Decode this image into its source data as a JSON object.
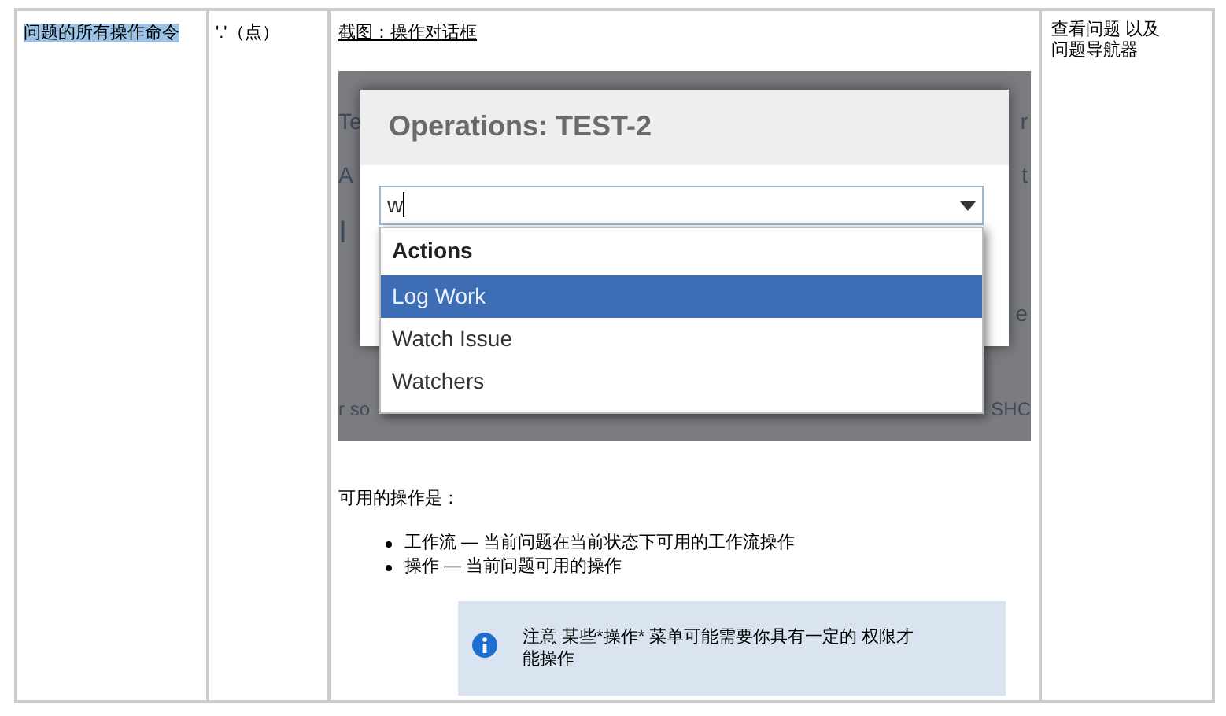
{
  "table": {
    "row": {
      "command": {
        "text": "问题的所有操作命令",
        "highlighted": true
      },
      "shortcut": "'.'（点）",
      "description": {
        "caption": "截图：操作对话框",
        "screenshot": {
          "background_fragments": [
            "Te",
            "r",
            "A",
            "t",
            "I",
            "e",
            "r so",
            "SHC"
          ],
          "dialog": {
            "title": "Operations: TEST-2",
            "input_value": "w",
            "dropdown": {
              "group": "Actions",
              "items": [
                {
                  "label": "Log Work",
                  "selected": true
                },
                {
                  "label": "Watch Issue",
                  "selected": false
                },
                {
                  "label": "Watchers",
                  "selected": false
                }
              ]
            }
          }
        },
        "intro": "可用的操作是：",
        "bullets": [
          "工作流 — 当前问题在当前状态下可用的工作流操作",
          "操作 — 当前问题可用的操作"
        ],
        "note": "注意 某些*操作* 菜单可能需要你具有一定的 权限才能操作"
      },
      "context": "查看问题 以及问题导航器"
    }
  }
}
